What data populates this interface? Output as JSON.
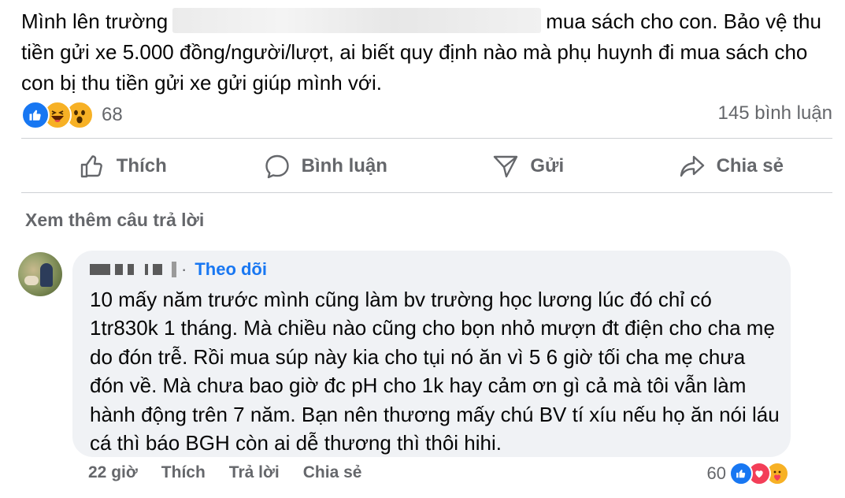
{
  "post": {
    "text_before": "Mình lên trường",
    "text_after": "mua sách cho con. Bảo vệ thu tiền gửi xe 5.000 đồng/người/lượt, ai biết quy định nào mà phụ huynh đi mua sách cho con bị thu tiền gửi xe gửi giúp mình với."
  },
  "stats": {
    "reaction_count": "68",
    "comment_count": "145 bình luận",
    "reactions": [
      "like-icon",
      "haha-icon",
      "wow-icon"
    ]
  },
  "actions": {
    "like": "Thích",
    "comment": "Bình luận",
    "send": "Gửi",
    "share": "Chia sẻ"
  },
  "more_replies": "Xem thêm câu trả lời",
  "comment": {
    "follow": "Theo dõi",
    "separator": "·",
    "text": "10 mấy năm trước mình cũng làm bv trường học lương lúc đó chỉ có 1tr830k 1 tháng. Mà chiều nào cũng cho bọn nhỏ mượn đt điện cho cha mẹ do đón trễ. Rồi mua súp này kia cho tụi nó ăn vì 5 6 giờ tối cha mẹ chưa đón về. Mà chưa bao giờ đc pH cho 1k hay cảm ơn gì cả mà tôi vẫn làm hành động trên 7 năm. Bạn nên thương mấy chú BV tí xíu nếu họ ăn nói láu cá thì báo BGH còn ai dễ thương thì thôi hihi.",
    "time": "22 giờ",
    "like": "Thích",
    "reply": "Trả lời",
    "share": "Chia sẻ",
    "reaction_count": "60"
  },
  "colors": {
    "accent": "#1877f2",
    "secondary_text": "#65676b",
    "bubble": "#f0f2f5",
    "love": "#f33e58",
    "haha": "#f7b125"
  }
}
